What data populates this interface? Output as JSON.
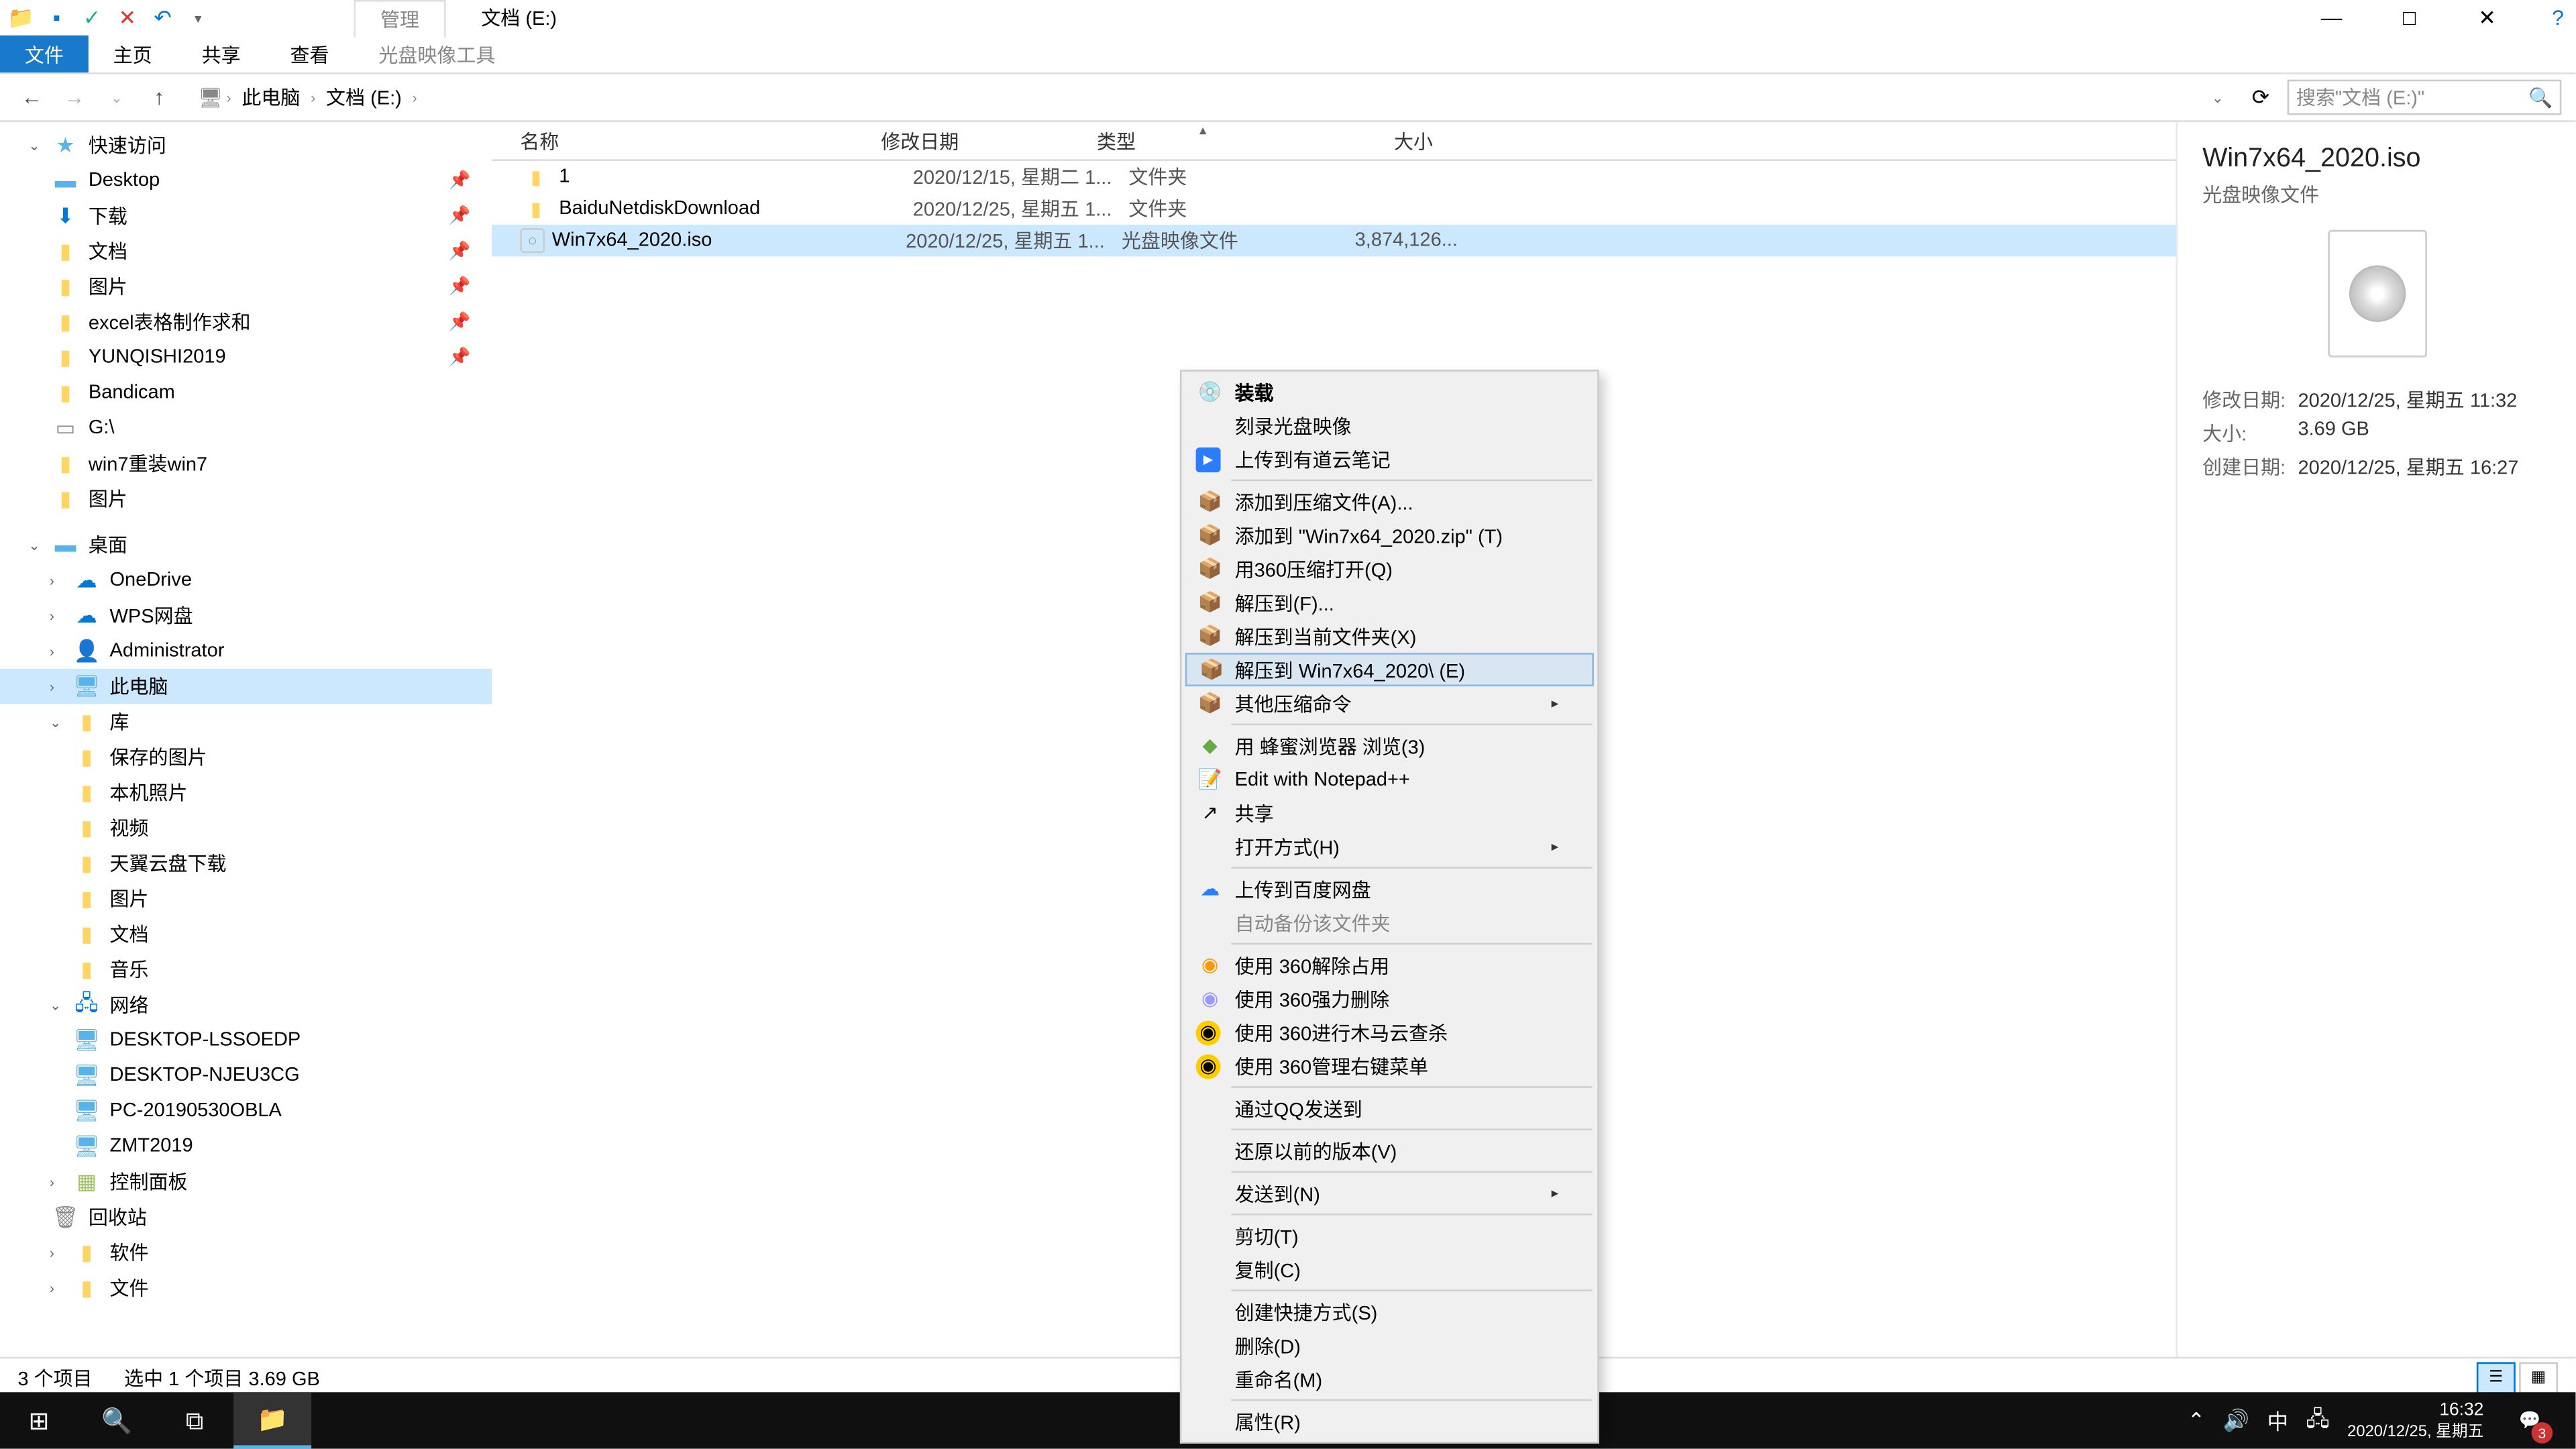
{
  "window": {
    "title": "文档 (E:)",
    "manage_tab": "管理",
    "minimize": "—",
    "maximize": "□",
    "close": "✕",
    "help": "?"
  },
  "ribbon": {
    "file": "文件",
    "home": "主页",
    "share": "共享",
    "view": "查看",
    "disc_tools": "光盘映像工具"
  },
  "address": {
    "pc": "此电脑",
    "loc": "文档 (E:)",
    "search_placeholder": "搜索\"文档 (E:)\""
  },
  "nav": {
    "quick_access": "快速访问",
    "desktop": "Desktop",
    "downloads": "下载",
    "documents": "文档",
    "pictures": "图片",
    "excel": "excel表格制作求和",
    "yunqishi": "YUNQISHI2019",
    "bandicam": "Bandicam",
    "g_drive": "G:\\",
    "win7reinstall": "win7重装win7",
    "pictures2": "图片",
    "desktop_group": "桌面",
    "onedrive": "OneDrive",
    "wps": "WPS网盘",
    "admin": "Administrator",
    "this_pc": "此电脑",
    "library": "库",
    "saved_pics": "保存的图片",
    "local_pics": "本机照片",
    "videos": "视频",
    "tianyi": "天翼云盘下载",
    "pictures3": "图片",
    "documents2": "文档",
    "music": "音乐",
    "network": "网络",
    "pc1": "DESKTOP-LSSOEDP",
    "pc2": "DESKTOP-NJEU3CG",
    "pc3": "PC-20190530OBLA",
    "pc4": "ZMT2019",
    "control_panel": "控制面板",
    "recycle": "回收站",
    "software": "软件",
    "files": "文件"
  },
  "columns": {
    "name": "名称",
    "date": "修改日期",
    "type": "类型",
    "size": "大小"
  },
  "files": [
    {
      "name": "1",
      "date": "2020/12/15, 星期二 1...",
      "type": "文件夹",
      "size": ""
    },
    {
      "name": "BaiduNetdiskDownload",
      "date": "2020/12/25, 星期五 1...",
      "type": "文件夹",
      "size": ""
    },
    {
      "name": "Win7x64_2020.iso",
      "date": "2020/12/25, 星期五 1...",
      "type": "光盘映像文件",
      "size": "3,874,126..."
    }
  ],
  "context_menu": {
    "mount": "装载",
    "burn": "刻录光盘映像",
    "youdao": "上传到有道云笔记",
    "add_archive": "添加到压缩文件(A)...",
    "add_zip": "添加到 \"Win7x64_2020.zip\" (T)",
    "open_360zip": "用360压缩打开(Q)",
    "extract_to": "解压到(F)...",
    "extract_here": "解压到当前文件夹(X)",
    "extract_named": "解压到 Win7x64_2020\\ (E)",
    "other_compress": "其他压缩命令",
    "bee_browser": "用 蜂蜜浏览器 浏览(3)",
    "notepad": "Edit with Notepad++",
    "share": "共享",
    "open_with": "打开方式(H)",
    "upload_baidu": "上传到百度网盘",
    "auto_backup": "自动备份该文件夹",
    "use_360_unlock": "使用 360解除占用",
    "use_360_delete": "使用 360强力删除",
    "use_360_trojan": "使用 360进行木马云查杀",
    "use_360_menu": "使用 360管理右键菜单",
    "qq_send": "通过QQ发送到",
    "restore_prev": "还原以前的版本(V)",
    "send_to": "发送到(N)",
    "cut": "剪切(T)",
    "copy": "复制(C)",
    "create_shortcut": "创建快捷方式(S)",
    "delete": "删除(D)",
    "rename": "重命名(M)",
    "properties": "属性(R)"
  },
  "preview": {
    "title": "Win7x64_2020.iso",
    "subtitle": "光盘映像文件",
    "meta": [
      {
        "label": "修改日期:",
        "value": "2020/12/25, 星期五 11:32"
      },
      {
        "label": "大小:",
        "value": "3.69 GB"
      },
      {
        "label": "创建日期:",
        "value": "2020/12/25, 星期五 16:27"
      }
    ]
  },
  "status": {
    "items": "3 个项目",
    "selected": "选中 1 个项目  3.69 GB"
  },
  "taskbar": {
    "ime": "中",
    "time": "16:32",
    "date": "2020/12/25, 星期五",
    "notif_count": "3"
  }
}
